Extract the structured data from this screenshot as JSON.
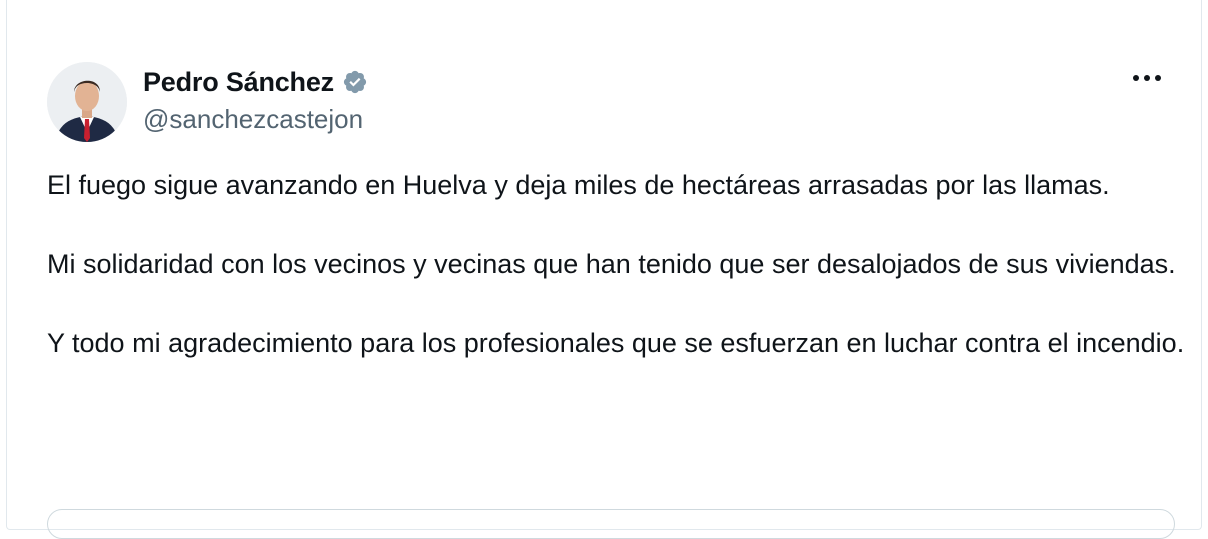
{
  "author": {
    "name": "Pedro Sánchez",
    "handle": "@sanchezcastejon",
    "verified_color": "#829aab"
  },
  "menu": {
    "more_icon": "more-horizontal-icon"
  },
  "tweet": {
    "paragraphs": [
      "El fuego sigue avanzando en Huelva y deja miles de hectáreas arrasadas por las llamas.",
      "Mi solidaridad con los vecinos y vecinas que han tenido que ser desalojados de sus viviendas.",
      "Y todo mi agradecimiento para los profesionales que se esfuerzan en luchar contra el incendio."
    ]
  },
  "colors": {
    "text_primary": "#0f1419",
    "text_secondary": "#536471",
    "border": "#cfd9de"
  }
}
